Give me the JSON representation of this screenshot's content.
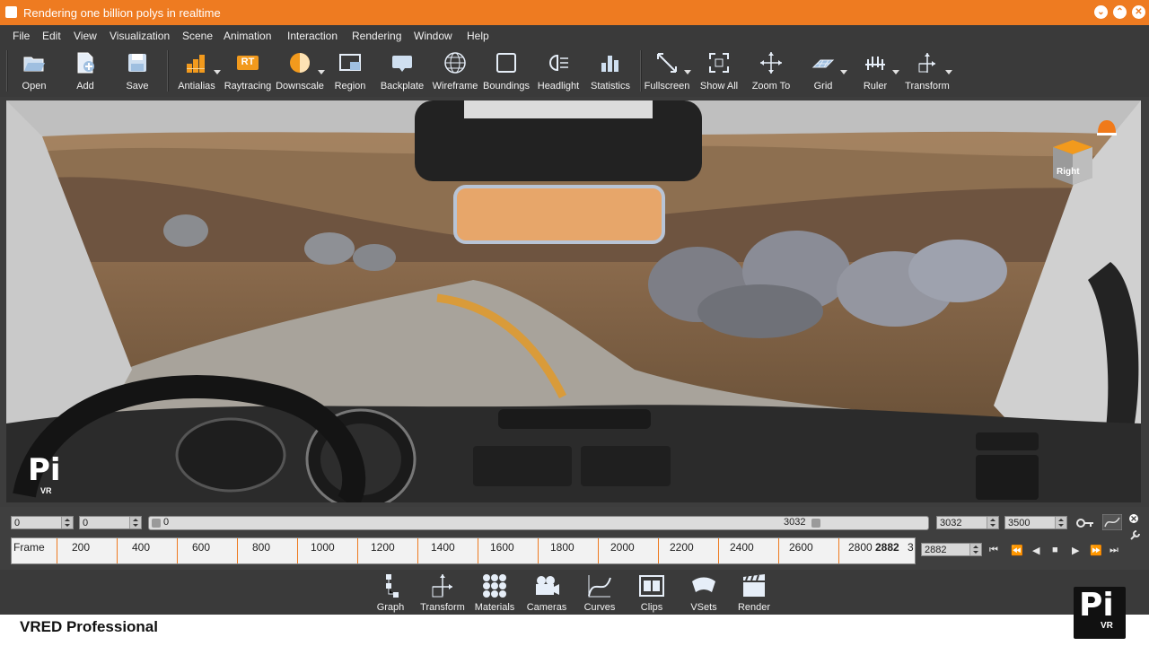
{
  "window": {
    "title": "Rendering one billion polys in realtime",
    "controls": [
      "minimize",
      "maximize",
      "close"
    ],
    "accent_color": "#ee7b21"
  },
  "menu": [
    "File",
    "Edit",
    "View",
    "Visualization",
    "Scene",
    "Animation",
    "Interaction",
    "Rendering",
    "Window",
    "Help"
  ],
  "toolbar": {
    "open": "Open",
    "add": "Add",
    "save": "Save",
    "antialias": "Antialias",
    "raytracing": "Raytracing",
    "raytracing_badge": "RT",
    "downscale": "Downscale",
    "region": "Region",
    "backplate": "Backplate",
    "wireframe": "Wireframe",
    "boundings": "Boundings",
    "headlight": "Headlight",
    "statistics": "Statistics",
    "fullscreen": "Fullscreen",
    "show_all": "Show All",
    "zoom_to": "Zoom To",
    "grid": "Grid",
    "ruler": "Ruler",
    "transform": "Transform"
  },
  "viewport": {
    "orientation_cube_label": "Right",
    "watermark": {
      "pi": "Pi",
      "vr": "VR"
    }
  },
  "animation": {
    "start_a": "0",
    "start_b": "0",
    "range_start_label": "0",
    "range_end_label": "3032",
    "end_a": "3032",
    "end_b": "3500",
    "current_frame": "2882",
    "frame_label": "Frame",
    "ticks": [
      "200",
      "400",
      "600",
      "800",
      "1000",
      "1200",
      "1400",
      "1600",
      "1800",
      "2000",
      "2200",
      "2400",
      "2600",
      "2800"
    ],
    "cursor_label": "2882",
    "tail_label": "3"
  },
  "dock": {
    "graph": "Graph",
    "transform": "Transform",
    "materials": "Materials",
    "cameras": "Cameras",
    "curves": "Curves",
    "clips": "Clips",
    "vsets": "VSets",
    "render": "Render"
  },
  "footer": {
    "brand": "VRED Professional",
    "logo_pi": "Pi",
    "logo_vr": "VR"
  }
}
